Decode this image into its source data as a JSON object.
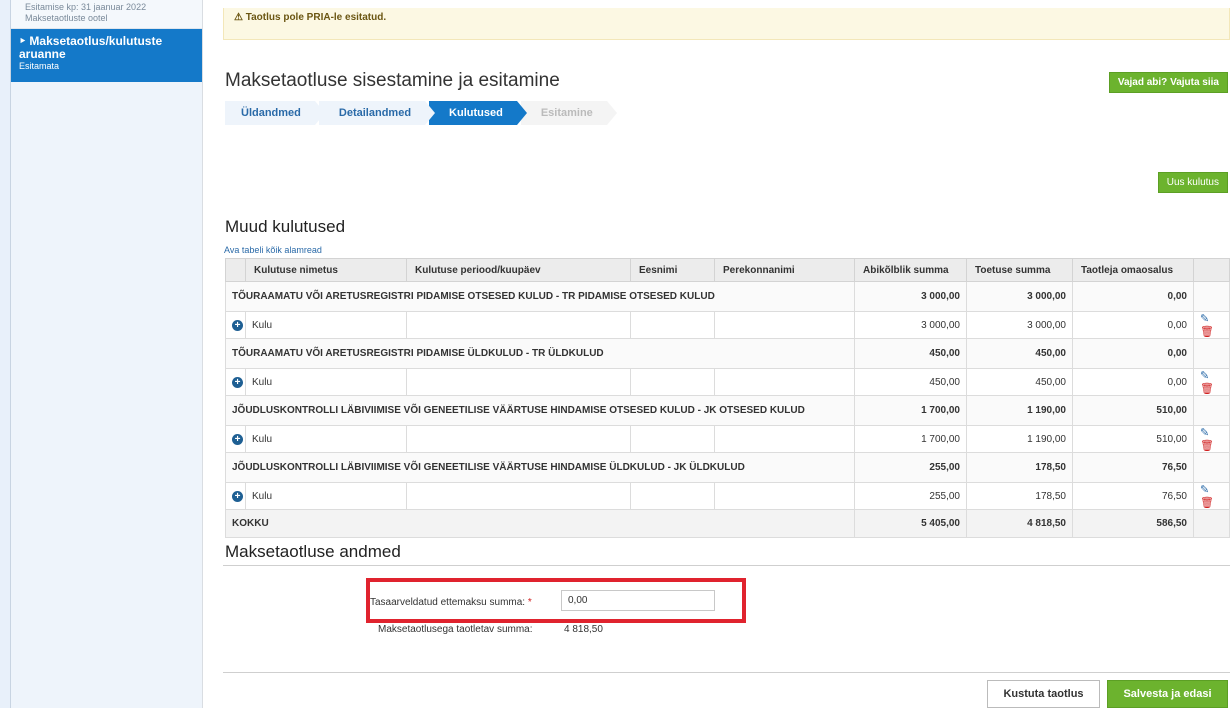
{
  "sidebar": {
    "prev_item": {
      "date_line": "Esitamise kp: 31 jaanuar 2022",
      "status": "Maksetaotluste ootel"
    },
    "active_item": {
      "title": "Maksetaotlus/kulutuste aruanne",
      "status": "Esitamata"
    }
  },
  "alert": {
    "text": "Taotlus pole PRIA-le esitatud."
  },
  "page": {
    "title": "Maksetaotluse sisestamine ja esitamine"
  },
  "help_button": "Vajad abi? Vajuta siia",
  "steps": [
    {
      "label": "Üldandmed",
      "state": "done"
    },
    {
      "label": "Detailandmed",
      "state": "done"
    },
    {
      "label": "Kulutused",
      "state": "active"
    },
    {
      "label": "Esitamine",
      "state": "disabled"
    }
  ],
  "new_expense_button": "Uus kulutus",
  "expenses": {
    "title": "Muud kulutused",
    "expand_link": "Ava tabeli kõik alamread",
    "columns": [
      "Kulutuse nimetus",
      "Kulutuse periood/kuupäev",
      "Eesnimi",
      "Perekonnanimi",
      "Abikõlblik summa",
      "Toetuse summa",
      "Taotleja omaosalus"
    ],
    "groups": [
      {
        "title": "TÕURAAMATU VÕI ARETUSREGISTRI PIDAMISE OTSESED KULUD - TR PIDAMISE OTSESED KULUD",
        "eligible": "3 000,00",
        "support": "3 000,00",
        "own": "0,00",
        "row": {
          "name": "Kulu",
          "eligible": "3 000,00",
          "support": "3 000,00",
          "own": "0,00"
        }
      },
      {
        "title": "TÕURAAMATU VÕI ARETUSREGISTRI PIDAMISE ÜLDKULUD - TR ÜLDKULUD",
        "eligible": "450,00",
        "support": "450,00",
        "own": "0,00",
        "row": {
          "name": "Kulu",
          "eligible": "450,00",
          "support": "450,00",
          "own": "0,00"
        }
      },
      {
        "title": "JÕUDLUSKONTROLLI LÄBIVIIMISE VÕI GENEETILISE VÄÄRTUSE HINDAMISE OTSESED KULUD - JK OTSESED KULUD",
        "eligible": "1 700,00",
        "support": "1 190,00",
        "own": "510,00",
        "row": {
          "name": "Kulu",
          "eligible": "1 700,00",
          "support": "1 190,00",
          "own": "510,00"
        }
      },
      {
        "title": "JÕUDLUSKONTROLLI LÄBIVIIMISE VÕI GENEETILISE VÄÄRTUSE HINDAMISE ÜLDKULUD - JK ÜLDKULUD",
        "eligible": "255,00",
        "support": "178,50",
        "own": "76,50",
        "row": {
          "name": "Kulu",
          "eligible": "255,00",
          "support": "178,50",
          "own": "76,50"
        }
      }
    ],
    "total": {
      "label": "KOKKU",
      "eligible": "5 405,00",
      "support": "4 818,50",
      "own": "586,50"
    }
  },
  "payment": {
    "title": "Maksetaotluse andmed",
    "advance_label": "Tasaarveldatud ettemaksu summa:",
    "required_mark": "*",
    "advance_value": "0,00",
    "requested_label": "Maksetaotlusega taotletav summa:",
    "requested_value": "4 818,50"
  },
  "actions": {
    "delete_label": "Kustuta taotlus",
    "save_label": "Salvesta ja edasi"
  },
  "colors": {
    "primary": "#1479c9",
    "accent_green": "#6cb32e",
    "highlight_red": "#e0232e",
    "alert_bg": "#fcf8e3"
  }
}
